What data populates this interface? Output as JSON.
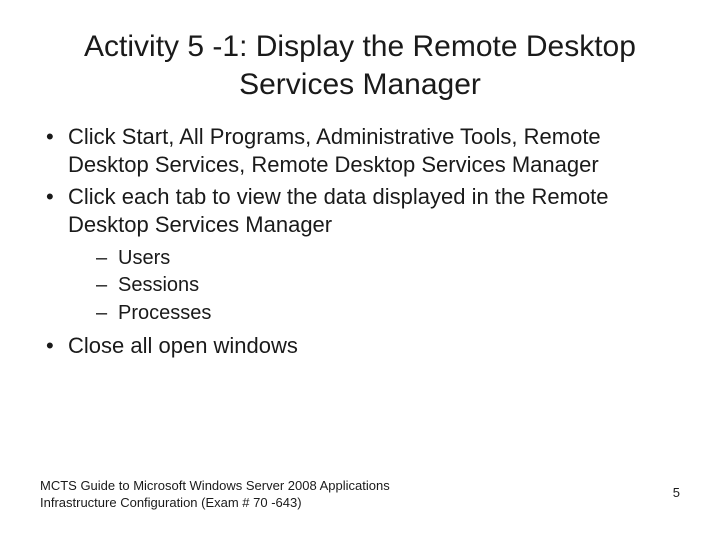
{
  "title": "Activity 5 -1: Display the Remote Desktop Services Manager",
  "bullets": {
    "b1": "Click Start, All Programs, Administrative Tools, Remote Desktop Services, Remote Desktop Services Manager",
    "b2": "Click each tab to view the data displayed in the Remote Desktop Services Manager",
    "sub": {
      "s1": "Users",
      "s2": "Sessions",
      "s3": "Processes"
    },
    "b3": "Close all open windows"
  },
  "footer": {
    "left": "MCTS Guide to Microsoft Windows Server 2008 Applications Infrastructure Configuration (Exam # 70 -643)",
    "page": "5"
  }
}
